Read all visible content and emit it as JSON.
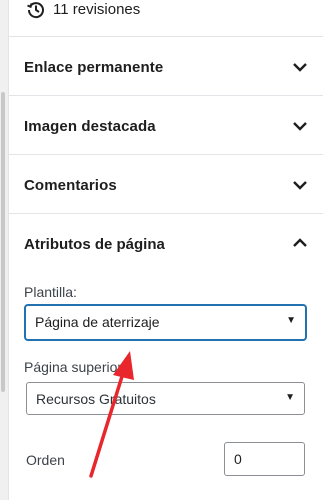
{
  "revisions": {
    "label": "11 revisiones",
    "icon": "history-icon"
  },
  "sections": [
    {
      "title": "Enlace permanente",
      "icon": "chevron-down-icon"
    },
    {
      "title": "Imagen destacada",
      "icon": "chevron-down-icon"
    },
    {
      "title": "Comentarios",
      "icon": "chevron-down-icon"
    }
  ],
  "page_attributes": {
    "title": "Atributos de página",
    "icon": "chevron-up-icon",
    "template": {
      "label": "Plantilla:",
      "value": "Página de aterrizaje",
      "arrow": "▼"
    },
    "parent": {
      "label": "Página superior:",
      "value": "Recursos Gratuitos",
      "arrow": "▼"
    },
    "order": {
      "label": "Orden",
      "value": "0"
    }
  },
  "annotation": {
    "color": "#e8262b",
    "icon": "red-arrow-annotation"
  },
  "colors": {
    "focus_border": "#2271b1",
    "divider": "#e2e4e7"
  }
}
